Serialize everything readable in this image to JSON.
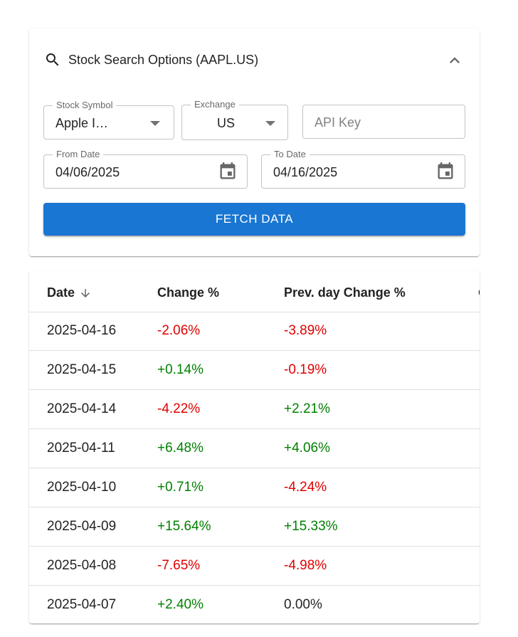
{
  "search_panel": {
    "title": "Stock Search Options (AAPL.US)",
    "icons": {
      "search": "search-icon",
      "collapse": "chevron-up-icon",
      "calendar": "calendar-icon",
      "dropdown": "arrow-drop-down-icon"
    },
    "stock_symbol": {
      "label": "Stock Symbol",
      "value": "Apple I…"
    },
    "exchange": {
      "label": "Exchange",
      "value": "US"
    },
    "api_key": {
      "placeholder": "API Key",
      "value": ""
    },
    "from_date": {
      "label": "From Date",
      "value": "04/06/2025"
    },
    "to_date": {
      "label": "To Date",
      "value": "04/16/2025"
    },
    "fetch_button": "FETCH DATA",
    "accent_color": "#1976d2"
  },
  "table": {
    "columns": [
      "Date",
      "Change %",
      "Prev. day Change %"
    ],
    "sort": {
      "column": "Date",
      "direction": "desc",
      "icon": "arrow-downward-icon"
    },
    "colors": {
      "negative": "#e00000",
      "positive": "#008000"
    },
    "rows": [
      {
        "date": "2025-04-16",
        "change": "-2.06%",
        "prev_change": "-3.89%"
      },
      {
        "date": "2025-04-15",
        "change": "+0.14%",
        "prev_change": "-0.19%"
      },
      {
        "date": "2025-04-14",
        "change": "-4.22%",
        "prev_change": "+2.21%"
      },
      {
        "date": "2025-04-11",
        "change": "+6.48%",
        "prev_change": "+4.06%"
      },
      {
        "date": "2025-04-10",
        "change": "+0.71%",
        "prev_change": "-4.24%"
      },
      {
        "date": "2025-04-09",
        "change": "+15.64%",
        "prev_change": "+15.33%"
      },
      {
        "date": "2025-04-08",
        "change": "-7.65%",
        "prev_change": "-4.98%"
      },
      {
        "date": "2025-04-07",
        "change": "+2.40%",
        "prev_change": "0.00%"
      }
    ]
  }
}
